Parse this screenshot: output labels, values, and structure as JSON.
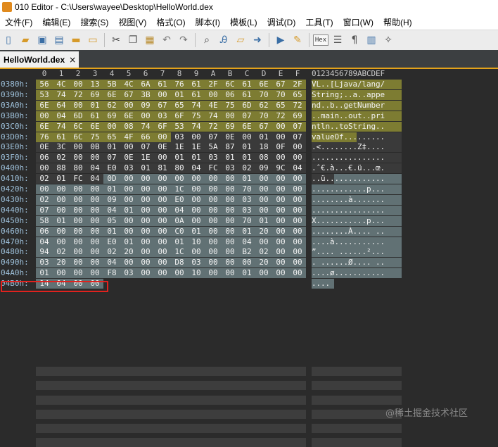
{
  "window": {
    "title": "010 Editor - C:\\Users\\wayee\\Desktop\\HelloWorld.dex"
  },
  "menu": [
    "文件(F)",
    "编辑(E)",
    "搜索(S)",
    "视图(V)",
    "格式(O)",
    "脚本(I)",
    "模板(L)",
    "调试(D)",
    "工具(T)",
    "窗口(W)",
    "帮助(H)"
  ],
  "toolbar": {
    "icons": [
      "new-file-icon",
      "open-file-icon",
      "save-icon",
      "save-all-icon",
      "folder-icon",
      "multi-folder-icon",
      "cut-icon",
      "copy-icon",
      "paste-icon",
      "undo-icon",
      "redo-icon",
      "find-icon",
      "replace-icon",
      "find-files-icon",
      "goto-icon",
      "run-script-icon",
      "run-template-icon",
      "hex-toggle",
      "text-ruler-icon",
      "pilcrow-icon",
      "columns-icon",
      "tools-icon"
    ],
    "hex_label": "Hex"
  },
  "tab": {
    "label": "HelloWorld.dex",
    "close": "×"
  },
  "editor": {
    "hex_columns": [
      "0",
      "1",
      "2",
      "3",
      "4",
      "5",
      "6",
      "7",
      "8",
      "9",
      "A",
      "B",
      "C",
      "D",
      "E",
      "F"
    ],
    "ascii_ruler": "0123456789ABCDEF",
    "rows": [
      {
        "addr": "0380h:",
        "bytes": [
          "56",
          "4C",
          "00",
          "13",
          "5B",
          "4C",
          "6A",
          "61",
          "76",
          "61",
          "2F",
          "6C",
          "61",
          "6E",
          "67",
          "2F"
        ],
        "ascii": "VL..[Ljava/lang/"
      },
      {
        "addr": "0390h:",
        "bytes": [
          "53",
          "74",
          "72",
          "69",
          "6E",
          "67",
          "3B",
          "00",
          "01",
          "61",
          "00",
          "06",
          "61",
          "70",
          "70",
          "65"
        ],
        "ascii": "String;..a..appe"
      },
      {
        "addr": "03A0h:",
        "bytes": [
          "6E",
          "64",
          "00",
          "01",
          "62",
          "00",
          "09",
          "67",
          "65",
          "74",
          "4E",
          "75",
          "6D",
          "62",
          "65",
          "72"
        ],
        "ascii": "nd..b..getNumber"
      },
      {
        "addr": "03B0h:",
        "bytes": [
          "00",
          "04",
          "6D",
          "61",
          "69",
          "6E",
          "00",
          "03",
          "6F",
          "75",
          "74",
          "00",
          "07",
          "70",
          "72",
          "69"
        ],
        "ascii": "..main..out..pri"
      },
      {
        "addr": "03C0h:",
        "bytes": [
          "6E",
          "74",
          "6C",
          "6E",
          "00",
          "08",
          "74",
          "6F",
          "53",
          "74",
          "72",
          "69",
          "6E",
          "67",
          "00",
          "07"
        ],
        "ascii": "ntln..toString.."
      },
      {
        "addr": "03D0h:",
        "bytes": [
          "76",
          "61",
          "6C",
          "75",
          "65",
          "4F",
          "66",
          "00",
          "03",
          "00",
          "07",
          "0E",
          "00",
          "01",
          "00",
          "07"
        ],
        "ascii": "valueOf........."
      },
      {
        "addr": "03E0h:",
        "bytes": [
          "0E",
          "3C",
          "00",
          "0B",
          "01",
          "00",
          "07",
          "0E",
          "1E",
          "1E",
          "5A",
          "87",
          "01",
          "18",
          "0F",
          "00"
        ],
        "ascii": ".<........Z‡...."
      },
      {
        "addr": "03F0h:",
        "bytes": [
          "06",
          "02",
          "00",
          "00",
          "07",
          "0E",
          "1E",
          "00",
          "01",
          "01",
          "03",
          "01",
          "01",
          "08",
          "00",
          "00"
        ],
        "ascii": "................"
      },
      {
        "addr": "0400h:",
        "bytes": [
          "00",
          "88",
          "80",
          "04",
          "E0",
          "03",
          "01",
          "81",
          "80",
          "04",
          "FC",
          "03",
          "02",
          "09",
          "9C",
          "04"
        ],
        "ascii": ".ˆ€.à...€.ü...œ."
      },
      {
        "addr": "0410h:",
        "bytes": [
          "02",
          "01",
          "FC",
          "04",
          "0D",
          "00",
          "00",
          "00",
          "00",
          "00",
          "00",
          "00",
          "01",
          "00",
          "00",
          "00"
        ],
        "ascii": "..ü............."
      },
      {
        "addr": "0420h:",
        "bytes": [
          "00",
          "00",
          "00",
          "00",
          "01",
          "00",
          "00",
          "00",
          "1C",
          "00",
          "00",
          "00",
          "70",
          "00",
          "00",
          "00"
        ],
        "ascii": "............p..."
      },
      {
        "addr": "0430h:",
        "bytes": [
          "02",
          "00",
          "00",
          "00",
          "09",
          "00",
          "00",
          "00",
          "E0",
          "00",
          "00",
          "00",
          "03",
          "00",
          "00",
          "00"
        ],
        "ascii": "........à......."
      },
      {
        "addr": "0440h:",
        "bytes": [
          "07",
          "00",
          "00",
          "00",
          "04",
          "01",
          "00",
          "00",
          "04",
          "00",
          "00",
          "00",
          "03",
          "00",
          "00",
          "00"
        ],
        "ascii": "................"
      },
      {
        "addr": "0450h:",
        "bytes": [
          "58",
          "01",
          "00",
          "00",
          "05",
          "00",
          "00",
          "00",
          "0A",
          "00",
          "00",
          "00",
          "70",
          "01",
          "00",
          "00"
        ],
        "ascii": "X...........p..."
      },
      {
        "addr": "0460h:",
        "bytes": [
          "06",
          "00",
          "00",
          "00",
          "01",
          "00",
          "00",
          "00",
          "C0",
          "01",
          "00",
          "00",
          "01",
          "20",
          "00",
          "00"
        ],
        "ascii": "........À.... .."
      },
      {
        "addr": "0470h:",
        "bytes": [
          "04",
          "00",
          "00",
          "00",
          "E0",
          "01",
          "00",
          "00",
          "01",
          "10",
          "00",
          "00",
          "04",
          "00",
          "00",
          "00"
        ],
        "ascii": "....à..........."
      },
      {
        "addr": "0480h:",
        "bytes": [
          "94",
          "02",
          "00",
          "00",
          "02",
          "20",
          "00",
          "00",
          "1C",
          "00",
          "00",
          "00",
          "B2",
          "02",
          "00",
          "00"
        ],
        "ascii": "”.... ......²..."
      },
      {
        "addr": "0490h:",
        "bytes": [
          "03",
          "20",
          "00",
          "00",
          "04",
          "00",
          "00",
          "00",
          "D8",
          "03",
          "00",
          "00",
          "00",
          "20",
          "00",
          "00"
        ],
        "ascii": ". ......Ø.... .."
      },
      {
        "addr": "04A0h:",
        "bytes": [
          "01",
          "00",
          "00",
          "00",
          "F8",
          "03",
          "00",
          "00",
          "00",
          "10",
          "00",
          "00",
          "01",
          "00",
          "00",
          "00"
        ],
        "ascii": "....ø..........."
      },
      {
        "addr": "04B0h:",
        "bytes": [
          "14",
          "04",
          "00",
          "00"
        ],
        "ascii": "...."
      }
    ]
  },
  "watermark": "@稀土掘金技术社区"
}
